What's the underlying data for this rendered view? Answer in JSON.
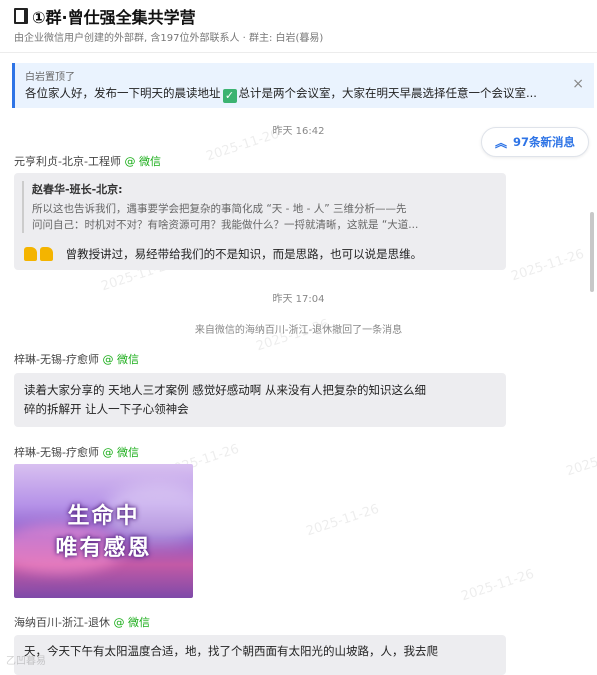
{
  "header": {
    "title": "①群·曾仕强全集共学营",
    "subtitle": "由企业微信用户创建的外部群, 含197位外部联系人 · 群主: 白岩(暮易)"
  },
  "pinned": {
    "label": "白岩置顶了",
    "text_before": "各位家人好，发布一下明天的晨读地址",
    "check_glyph": "✓",
    "text_after": "总计是两个会议室，大家在明天早晨选择任意一个会议室...",
    "close_glyph": "×"
  },
  "new_messages": {
    "icon": "︽",
    "label": "97条新消息"
  },
  "messages": {
    "t1": "昨天 16:42",
    "m1": {
      "sender": "元亨利贞-北京-工程师",
      "wechat": "@ 微信",
      "quote_author": "赵春华-班长-北京:",
      "quote_line1": "所以这也告诉我们，遇事要学会把复杂的事简化成 “天 - 地 - 人” 三维分析——先",
      "quote_line2": "问问自己：时机对不对？有啥资源可用？我能做什么？一捋就清晰，这就是 “大道...",
      "text": "曾教授讲过，易经带给我们的不是知识，而是思路，也可以说是思维。"
    },
    "t2": "昨天 17:04",
    "recall": "来自微信的海纳百川-浙江-退休撤回了一条消息",
    "m2": {
      "sender": "梓琳-无锡-疗愈师",
      "wechat": "@ 微信",
      "line1": "读着大家分享的 天地人三才案例  感觉好感动啊   从来没有人把复杂的知识这么细",
      "line2": "碎的拆解开  让人一下子心领神会"
    },
    "m3": {
      "sender": "梓琳-无锡-疗愈师",
      "wechat": "@ 微信",
      "image_line1": "生命中",
      "image_line2": "唯有感恩"
    },
    "m4": {
      "sender": "海纳百川-浙江-退休",
      "wechat": "@ 微信",
      "text": "天，今天下午有太阳温度合适，地，找了个朝西面有太阳光的山坡路，人，我去爬"
    }
  },
  "watermark": {
    "date": "2025-11-26",
    "name": "乙凹暮易"
  }
}
